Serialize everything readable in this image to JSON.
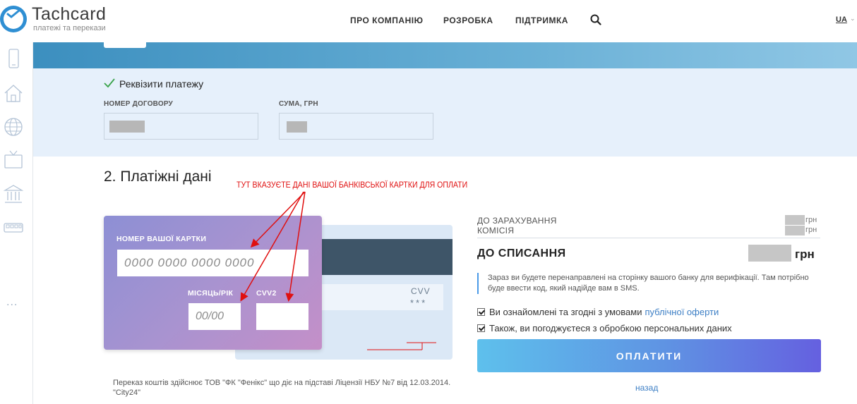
{
  "brand": {
    "name": "Tachcard",
    "tagline": "платежі та перекази"
  },
  "nav": {
    "about": "ПРО КОМПАНІЮ",
    "dev": "РОЗРОБКА",
    "support": "ПІДТРИМКА",
    "lang": "UA"
  },
  "sidebar": {
    "icons": [
      "phone-icon",
      "home-icon",
      "globe-icon",
      "tv-icon",
      "bank-icon",
      "transport-icon"
    ],
    "more": "..."
  },
  "details": {
    "title": "Реквізити платежу",
    "contract_label": "НОМЕР ДОГОВОРУ",
    "amount_label": "СУМА, ГРН"
  },
  "payment": {
    "title": "2. Платіжні дані",
    "annotation": "ТУТ ВКАЗУЄТЕ ДАНІ ВАШОЇ БАНКІВСЬКОЇ КАРТКИ ДЛЯ ОПЛАТИ",
    "card_number_label": "НОМЕР ВАШОЇ КАРТКИ",
    "card_number_placeholder": "0000 0000 0000 0000",
    "expiry_label": "МІСЯЦЬ/РІК",
    "expiry_placeholder": "00/00",
    "cvv2_label": "CVV2",
    "back_cvv_label": "CVV",
    "back_cvv_value": "***",
    "legal": "Переказ коштів здійснює ТОВ \"ФК \"Фенікс\" що діє на підставі Ліцензії НБУ №7 від 12.03.2014. \"City24\""
  },
  "summary": {
    "credit_label": "ДО ЗАРАХУВАННЯ",
    "fee_label": "КОМІСІЯ",
    "currency": "грн",
    "total_label": "ДО СПИСАННЯ",
    "info": "Зараз ви будете перенаправлені на сторінку вашого банку для верифікації. Там потрібно буде ввести код, який надійде вам в SMS.",
    "terms_prefix": "Ви ознайомлені та згодні з умовами",
    "terms_link": "публічної оферти",
    "privacy": "Також, ви погоджуєтеся з обробкою персональних даних",
    "pay_button": "ОПЛАТИТИ",
    "back": "назад"
  },
  "colors": {
    "accent_blue": "#3d7fc5",
    "annotation_red": "#e01010",
    "panel_bg": "#e6f0fb"
  }
}
